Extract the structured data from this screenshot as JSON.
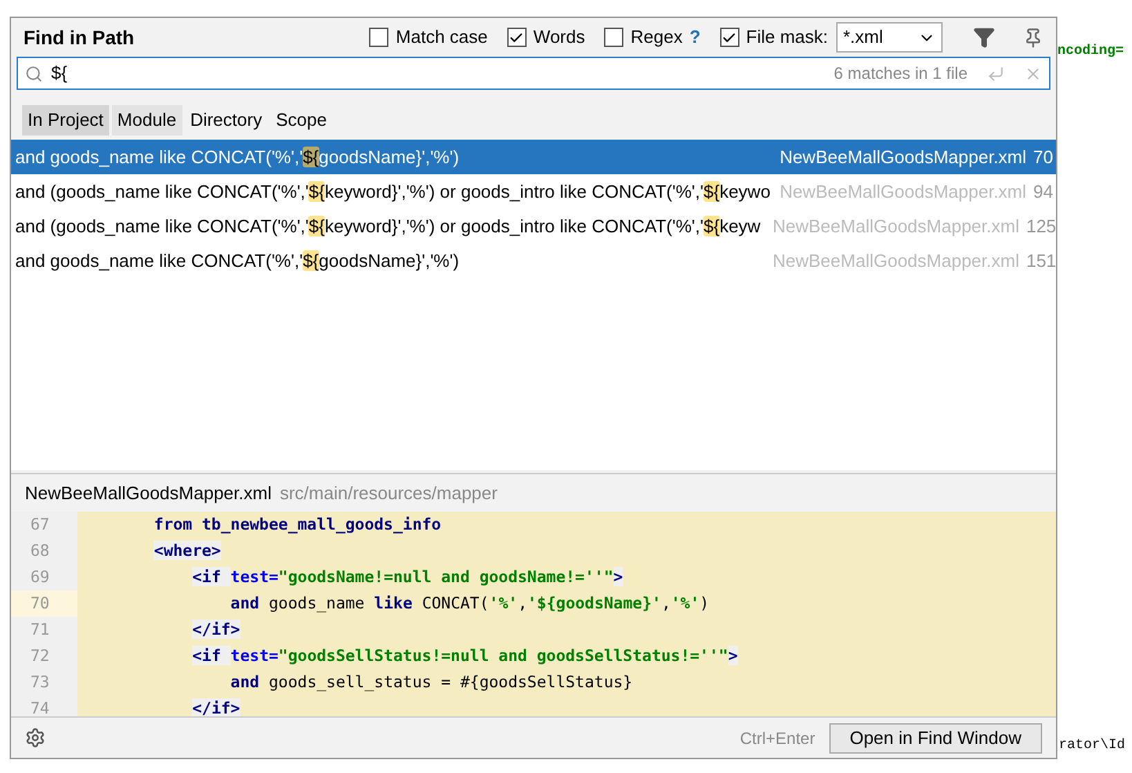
{
  "background": {
    "right_fragment": "ncoding=",
    "bottom_fragment": "rator\\Id"
  },
  "dialog": {
    "title": "Find in Path",
    "options": [
      {
        "label": "Match case",
        "checked": false
      },
      {
        "label": "Words",
        "checked": true
      },
      {
        "label": "Regex",
        "checked": false,
        "help": "?"
      },
      {
        "label": "File mask:",
        "checked": true
      }
    ],
    "file_mask": "*.xml",
    "search": {
      "value": "${",
      "status": "6 matches in 1 file"
    },
    "scopes": [
      {
        "label": "In Project",
        "selected": true
      },
      {
        "label": "Module",
        "selected": false
      },
      {
        "label": "Directory",
        "selected": false
      },
      {
        "label": "Scope",
        "selected": false
      }
    ],
    "results": [
      {
        "selected": true,
        "segments": [
          {
            "text": "and goods_name like CONCAT('%','",
            "match": false
          },
          {
            "text": "${",
            "match": true
          },
          {
            "text": "goodsName}','%')",
            "match": false
          }
        ],
        "file": "NewBeeMallGoodsMapper.xml",
        "line": "70"
      },
      {
        "selected": false,
        "segments": [
          {
            "text": "and (goods_name like CONCAT('%','",
            "match": false
          },
          {
            "text": "${",
            "match": true
          },
          {
            "text": "keyword}','%') or goods_intro like CONCAT('%','",
            "match": false
          },
          {
            "text": "${",
            "match": true
          },
          {
            "text": "keywo",
            "match": false
          }
        ],
        "file": "NewBeeMallGoodsMapper.xml",
        "line": "94"
      },
      {
        "selected": false,
        "segments": [
          {
            "text": "and (goods_name like CONCAT('%','",
            "match": false
          },
          {
            "text": "${",
            "match": true
          },
          {
            "text": "keyword}','%') or goods_intro like CONCAT('%','",
            "match": false
          },
          {
            "text": "${",
            "match": true
          },
          {
            "text": "keyw",
            "match": false
          }
        ],
        "file": "NewBeeMallGoodsMapper.xml",
        "line": "125"
      },
      {
        "selected": false,
        "segments": [
          {
            "text": "and goods_name like CONCAT('%','",
            "match": false
          },
          {
            "text": "${",
            "match": true
          },
          {
            "text": "goodsName}','%')",
            "match": false
          }
        ],
        "file": "NewBeeMallGoodsMapper.xml",
        "line": "151"
      }
    ],
    "preview": {
      "file": "NewBeeMallGoodsMapper.xml",
      "path": "src/main/resources/mapper",
      "lines": [
        {
          "number": "67",
          "current": false,
          "segments": [
            {
              "text": "        from tb_newbee_mall_goods_info",
              "kind": "keyword"
            }
          ]
        },
        {
          "number": "68",
          "current": false,
          "segments": [
            {
              "text": "        <where>",
              "kind": "tag"
            }
          ]
        },
        {
          "number": "69",
          "current": false,
          "segments": [
            {
              "text": "            <if ",
              "kind": "tag"
            },
            {
              "text": "test=",
              "kind": "attr"
            },
            {
              "text": "\"goodsName!=null and goodsName!=''\"",
              "kind": "string"
            },
            {
              "text": ">",
              "kind": "tag"
            }
          ]
        },
        {
          "number": "70",
          "current": true,
          "segments": [
            {
              "text": "                and",
              "kind": "keyword"
            },
            {
              "text": " goods_name ",
              "kind": "plain"
            },
            {
              "text": "like",
              "kind": "keyword"
            },
            {
              "text": " CONCAT(",
              "kind": "plain"
            },
            {
              "text": "'%'",
              "kind": "string"
            },
            {
              "text": ",",
              "kind": "plain"
            },
            {
              "text": "'${goodsName}'",
              "kind": "string"
            },
            {
              "text": ",",
              "kind": "plain"
            },
            {
              "text": "'%'",
              "kind": "string"
            },
            {
              "text": ")",
              "kind": "plain"
            }
          ]
        },
        {
          "number": "71",
          "current": false,
          "segments": [
            {
              "text": "            </if>",
              "kind": "tag"
            }
          ]
        },
        {
          "number": "72",
          "current": false,
          "segments": [
            {
              "text": "            <if ",
              "kind": "tag"
            },
            {
              "text": "test=",
              "kind": "attr"
            },
            {
              "text": "\"goodsSellStatus!=null and goodsSellStatus!=''\"",
              "kind": "string"
            },
            {
              "text": ">",
              "kind": "tag"
            }
          ]
        },
        {
          "number": "73",
          "current": false,
          "segments": [
            {
              "text": "                and",
              "kind": "keyword"
            },
            {
              "text": " goods_sell_status = #{goodsSellStatus}",
              "kind": "plain"
            }
          ]
        },
        {
          "number": "74",
          "current": false,
          "segments": [
            {
              "text": "            </if>",
              "kind": "tag"
            }
          ]
        }
      ]
    },
    "shortcut": "Ctrl+Enter",
    "open_button": "Open in Find Window"
  }
}
